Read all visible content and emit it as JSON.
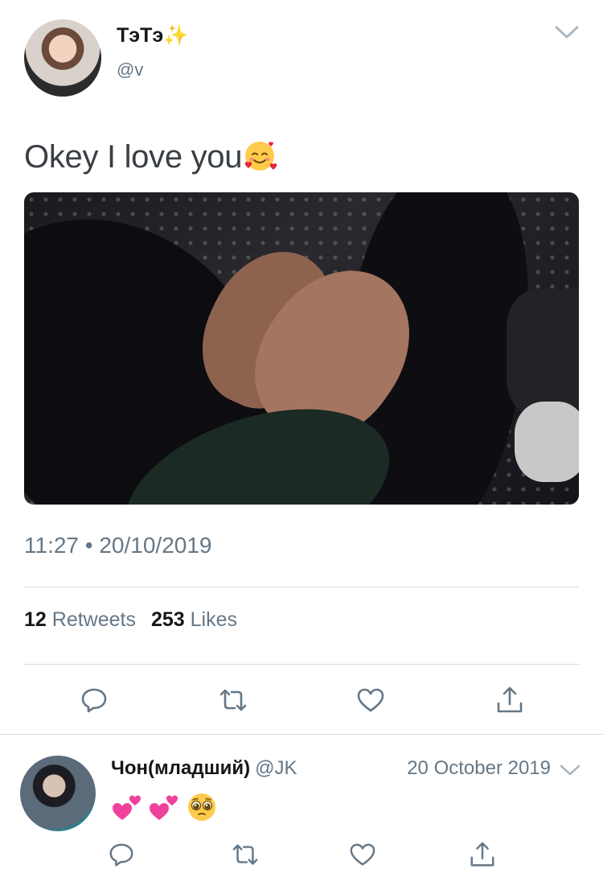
{
  "main_tweet": {
    "display_name": "ТэТэ",
    "name_emoji": "✨",
    "handle": "@v",
    "text": "Okey I love you",
    "text_emoji": "smiling-face-with-hearts",
    "timestamp": "11:27 • 20/10/2019",
    "stats": {
      "retweets_count": "12",
      "retweets_label": "Retweets",
      "likes_count": "253",
      "likes_label": "Likes"
    }
  },
  "reply": {
    "display_name": "Чон(младший)",
    "handle": "@JK",
    "date": "20 October 2019",
    "emojis": [
      "two-hearts",
      "two-hearts",
      "pleading-face"
    ]
  },
  "icons": {
    "reply": "reply-icon",
    "retweet": "retweet-icon",
    "like": "heart-icon",
    "share": "share-icon",
    "more": "chevron-down-icon"
  },
  "colors": {
    "text_primary": "#14171a",
    "text_secondary": "#657786",
    "divider": "#d6dadd",
    "icon": "#657786"
  }
}
